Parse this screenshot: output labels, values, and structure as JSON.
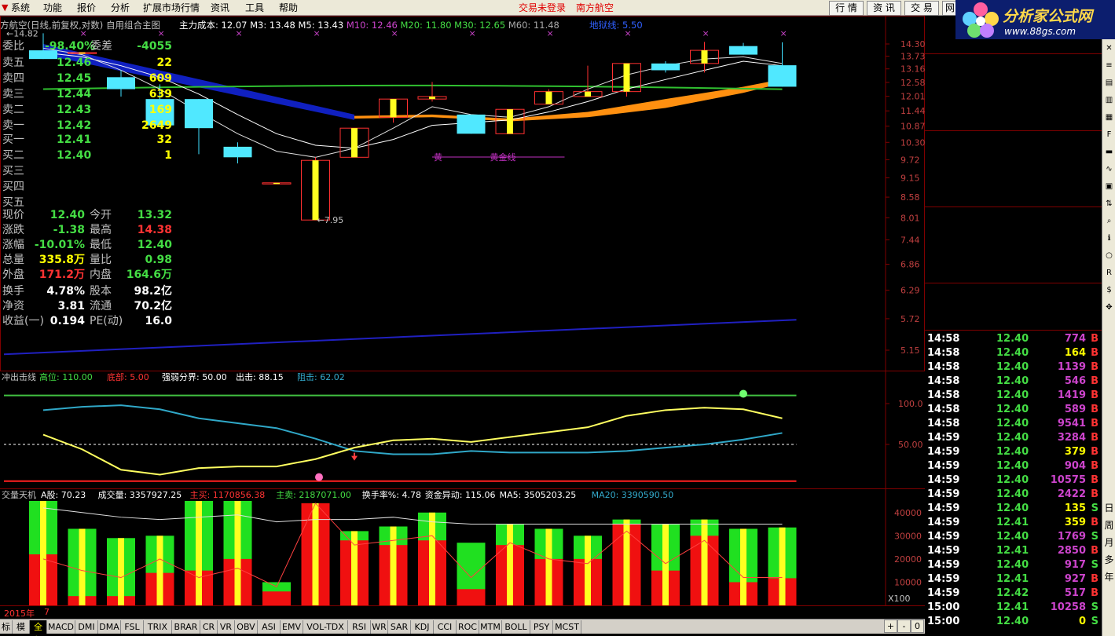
{
  "menu": {
    "items": [
      "系统",
      "功能",
      "报价",
      "分析",
      "扩展市场行情",
      "资讯",
      "工具",
      "帮助"
    ],
    "trade_status": "交易未登录",
    "stock_name": "南方航空",
    "right_buttons": [
      "行 情",
      "资 讯",
      "交 易",
      "网"
    ]
  },
  "watermark": {
    "text": "分析家公式网",
    "url": "www.88gs.com"
  },
  "main_chart": {
    "title": "方航空(日线,前复权,对数) 自用组合主图",
    "indicators": [
      {
        "label": "主力成本: 12.07",
        "color": "#ffffff"
      },
      {
        "label": "M3: 13.48",
        "color": "#ffffff"
      },
      {
        "label": "M5: 13.43",
        "color": "#ffffff"
      },
      {
        "label": "M10: 12.46",
        "color": "#cc44cc"
      },
      {
        "label": "M20: 11.80",
        "color": "#44dd44"
      },
      {
        "label": "M30: 12.65",
        "color": "#44dd44"
      },
      {
        "label": "M60: 11.48",
        "color": "#aaaaaa"
      }
    ],
    "extra_label": "地狱线: 5.50",
    "y_ticks": [
      "14.30",
      "13.73",
      "13.16",
      "12.58",
      "12.01",
      "11.44",
      "10.87",
      "10.30",
      "9.72",
      "9.15",
      "8.58",
      "8.01",
      "7.44",
      "6.86",
      "6.29",
      "5.72",
      "5.15"
    ],
    "high_label": "14.82",
    "low_label": "7.95",
    "gold_label_1": "黄",
    "gold_label_2": "黄金线"
  },
  "sub_chart1": {
    "title": "冲出击线",
    "items": [
      {
        "label": "高位: 110.00",
        "color": "#44dd44"
      },
      {
        "label": "底部: 5.00",
        "color": "#ff3333"
      },
      {
        "label": "强弱分界: 50.00",
        "color": "#ffffff"
      },
      {
        "label": "出击: 88.15",
        "color": "#ffffff"
      },
      {
        "label": "阻击: 62.02",
        "color": "#33aacc"
      }
    ],
    "y_ticks": [
      "100.0",
      "50.00"
    ]
  },
  "sub_chart2": {
    "title": "交量天机",
    "items": [
      {
        "label": "A股: 70.23",
        "color": "#ffffff"
      },
      {
        "label": "成交量: 3357927.25",
        "color": "#ffffff"
      },
      {
        "label": "主买: 1170856.38",
        "color": "#ff3333"
      },
      {
        "label": "主卖: 2187071.00",
        "color": "#44dd44"
      },
      {
        "label": "换手率%: 4.78",
        "color": "#ffffff"
      },
      {
        "label": "资金异动: 115.06",
        "color": "#ffffff"
      },
      {
        "label": "MA5: 3505203.25",
        "color": "#ffffff"
      },
      {
        "label": "MA20: 3390590.50",
        "color": "#33aacc"
      }
    ],
    "y_ticks": [
      "40000",
      "30000",
      "20000",
      "10000"
    ],
    "unit": "X100",
    "period": "日线"
  },
  "chart_data": {
    "type": "candlestick",
    "candles": [
      {
        "o": 14.0,
        "h": 14.82,
        "l": 13.6,
        "c": 13.6
      },
      {
        "o": 13.9,
        "h": 13.9,
        "l": 13.9,
        "c": 13.9
      },
      {
        "o": 12.8,
        "h": 13.1,
        "l": 12.0,
        "c": 12.3
      },
      {
        "o": 11.9,
        "h": 12.5,
        "l": 10.9,
        "c": 10.9
      },
      {
        "o": 11.9,
        "h": 11.9,
        "l": 9.9,
        "c": 10.8
      },
      {
        "o": 10.15,
        "h": 10.3,
        "l": 9.6,
        "c": 9.8
      },
      {
        "o": 9.0,
        "h": 9.0,
        "l": 9.0,
        "c": 9.0
      },
      {
        "o": 7.95,
        "h": 9.8,
        "l": 7.95,
        "c": 9.7
      },
      {
        "o": 9.8,
        "h": 10.8,
        "l": 9.8,
        "c": 10.8
      },
      {
        "o": 11.2,
        "h": 11.9,
        "l": 11.0,
        "c": 11.9
      },
      {
        "o": 11.9,
        "h": 12.6,
        "l": 11.8,
        "c": 12.0
      },
      {
        "o": 11.3,
        "h": 11.3,
        "l": 10.6,
        "c": 10.6
      },
      {
        "o": 10.6,
        "h": 11.5,
        "l": 10.6,
        "c": 11.5
      },
      {
        "o": 11.7,
        "h": 12.3,
        "l": 11.7,
        "c": 12.2
      },
      {
        "o": 12.0,
        "h": 13.3,
        "l": 12.0,
        "c": 12.2
      },
      {
        "o": 12.2,
        "h": 13.0,
        "l": 12.0,
        "c": 13.4
      },
      {
        "o": 13.4,
        "h": 13.5,
        "l": 13.0,
        "c": 13.1
      },
      {
        "o": 13.4,
        "h": 14.4,
        "l": 13.0,
        "c": 14.0
      },
      {
        "o": 14.2,
        "h": 14.35,
        "l": 13.8,
        "c": 13.8
      },
      {
        "o": 13.32,
        "h": 14.38,
        "l": 12.4,
        "c": 12.4
      }
    ],
    "volumes": [
      45000,
      33000,
      29000,
      30000,
      45000,
      45000,
      10000,
      44000,
      32000,
      34000,
      40000,
      27000,
      35000,
      33000,
      30000,
      37000,
      35000,
      37000,
      33000,
      33579
    ],
    "main_buy": [
      22000,
      4000,
      4000,
      14000,
      15000,
      20000,
      6000,
      44000,
      28000,
      26000,
      28000,
      7000,
      26000,
      20000,
      20000,
      35000,
      15000,
      30000,
      10000,
      11708
    ],
    "strength_line": [
      52,
      34,
      9,
      3,
      11,
      13,
      13,
      22,
      36,
      45,
      47,
      43,
      49,
      55,
      61,
      75,
      82,
      85,
      83,
      72
    ]
  },
  "quote_panel": {
    "ratio_label": "委比",
    "ratio_value": "-98.40%",
    "diff_label": "委差",
    "diff_value": "-4055",
    "sells": [
      {
        "label": "卖五",
        "price": "12.46",
        "vol": "22"
      },
      {
        "label": "卖四",
        "price": "12.45",
        "vol": "609"
      },
      {
        "label": "卖三",
        "price": "12.44",
        "vol": "639"
      },
      {
        "label": "卖二",
        "price": "12.43",
        "vol": "169"
      },
      {
        "label": "卖一",
        "price": "12.42",
        "vol": "2649"
      }
    ],
    "buys": [
      {
        "label": "买一",
        "price": "12.41",
        "vol": "32"
      },
      {
        "label": "买二",
        "price": "12.40",
        "vol": "1"
      },
      {
        "label": "买三",
        "price": "",
        "vol": ""
      },
      {
        "label": "买四",
        "price": "",
        "vol": ""
      },
      {
        "label": "买五",
        "price": "",
        "vol": ""
      }
    ],
    "stats": [
      {
        "l1": "现价",
        "v1": "12.40",
        "c1": "#44dd44",
        "l2": "今开",
        "v2": "13.32",
        "c2": "#44dd44"
      },
      {
        "l1": "涨跌",
        "v1": "-1.38",
        "c1": "#44dd44",
        "l2": "最高",
        "v2": "14.38",
        "c2": "#ff3333"
      },
      {
        "l1": "涨幅",
        "v1": "-10.01%",
        "c1": "#44dd44",
        "l2": "最低",
        "v2": "12.40",
        "c2": "#44dd44"
      },
      {
        "l1": "总量",
        "v1": "335.8万",
        "c1": "#ffff00",
        "l2": "量比",
        "v2": "0.98",
        "c2": "#44dd44"
      },
      {
        "l1": "外盘",
        "v1": "171.2万",
        "c1": "#ff3333",
        "l2": "内盘",
        "v2": "164.6万",
        "c2": "#44dd44"
      }
    ],
    "stats2": [
      {
        "l1": "换手",
        "v1": "4.78%",
        "l2": "股本",
        "v2": "98.2亿"
      },
      {
        "l1": "净资",
        "v1": "3.81",
        "l2": "流通",
        "v2": "70.2亿"
      },
      {
        "l1": "收益(一)",
        "v1": "0.194",
        "l2": "PE(动)",
        "v2": "16.0"
      }
    ]
  },
  "ticks": [
    {
      "t": "14:58",
      "p": "12.40",
      "v": "774",
      "vc": "#cc44cc",
      "s": "B"
    },
    {
      "t": "14:58",
      "p": "12.40",
      "v": "164",
      "vc": "#ffff00",
      "s": "B"
    },
    {
      "t": "14:58",
      "p": "12.40",
      "v": "1139",
      "vc": "#cc44cc",
      "s": "B"
    },
    {
      "t": "14:58",
      "p": "12.40",
      "v": "546",
      "vc": "#cc44cc",
      "s": "B"
    },
    {
      "t": "14:58",
      "p": "12.40",
      "v": "1419",
      "vc": "#cc44cc",
      "s": "B"
    },
    {
      "t": "14:58",
      "p": "12.40",
      "v": "589",
      "vc": "#cc44cc",
      "s": "B"
    },
    {
      "t": "14:58",
      "p": "12.40",
      "v": "9541",
      "vc": "#cc44cc",
      "s": "B"
    },
    {
      "t": "14:59",
      "p": "12.40",
      "v": "3284",
      "vc": "#cc44cc",
      "s": "B"
    },
    {
      "t": "14:59",
      "p": "12.40",
      "v": "379",
      "vc": "#ffff00",
      "s": "B"
    },
    {
      "t": "14:59",
      "p": "12.40",
      "v": "904",
      "vc": "#cc44cc",
      "s": "B"
    },
    {
      "t": "14:59",
      "p": "12.40",
      "v": "10575",
      "vc": "#cc44cc",
      "s": "B"
    },
    {
      "t": "14:59",
      "p": "12.40",
      "v": "2422",
      "vc": "#cc44cc",
      "s": "B"
    },
    {
      "t": "14:59",
      "p": "12.40",
      "v": "135",
      "vc": "#ffff00",
      "s": "S"
    },
    {
      "t": "14:59",
      "p": "12.41",
      "v": "359",
      "vc": "#ffff00",
      "s": "B"
    },
    {
      "t": "14:59",
      "p": "12.40",
      "v": "1769",
      "vc": "#cc44cc",
      "s": "S"
    },
    {
      "t": "14:59",
      "p": "12.41",
      "v": "2850",
      "vc": "#cc44cc",
      "s": "B"
    },
    {
      "t": "14:59",
      "p": "12.40",
      "v": "917",
      "vc": "#cc44cc",
      "s": "S"
    },
    {
      "t": "14:59",
      "p": "12.41",
      "v": "927",
      "vc": "#cc44cc",
      "s": "B"
    },
    {
      "t": "14:59",
      "p": "12.42",
      "v": "517",
      "vc": "#cc44cc",
      "s": "B"
    },
    {
      "t": "15:00",
      "p": "12.41",
      "v": "10258",
      "vc": "#cc44cc",
      "s": "S"
    },
    {
      "t": "15:00",
      "p": "12.40",
      "v": "0",
      "vc": "#ffff00",
      "s": "S"
    }
  ],
  "sidebar_icons": [
    "x-icon",
    "list-icon",
    "chart-icon",
    "k-icon",
    "grid-icon",
    "f10-icon",
    "bar-icon",
    "line-icon",
    "table-icon",
    "rank-icon",
    "search-icon",
    "info-icon",
    "circle-icon",
    "rss-icon",
    "dollar-icon",
    "arrow-icon"
  ],
  "sidebar_text": [
    "日",
    "周",
    "月",
    "多",
    "年"
  ],
  "date_row": {
    "year": "2015年",
    "month": "7"
  },
  "tabs": [
    "标",
    "模板",
    "全部",
    "MACD",
    "DMI",
    "DMA",
    "FSL",
    "TRIX",
    "BRAR",
    "CR",
    "VR",
    "OBV",
    "ASI",
    "EMV",
    "VOL-TDX",
    "RSI",
    "WR",
    "SAR",
    "KDJ",
    "CCI",
    "ROC",
    "MTM",
    "BOLL",
    "PSY",
    "MCST"
  ],
  "scroll_buttons": [
    "+",
    "-",
    "0"
  ]
}
